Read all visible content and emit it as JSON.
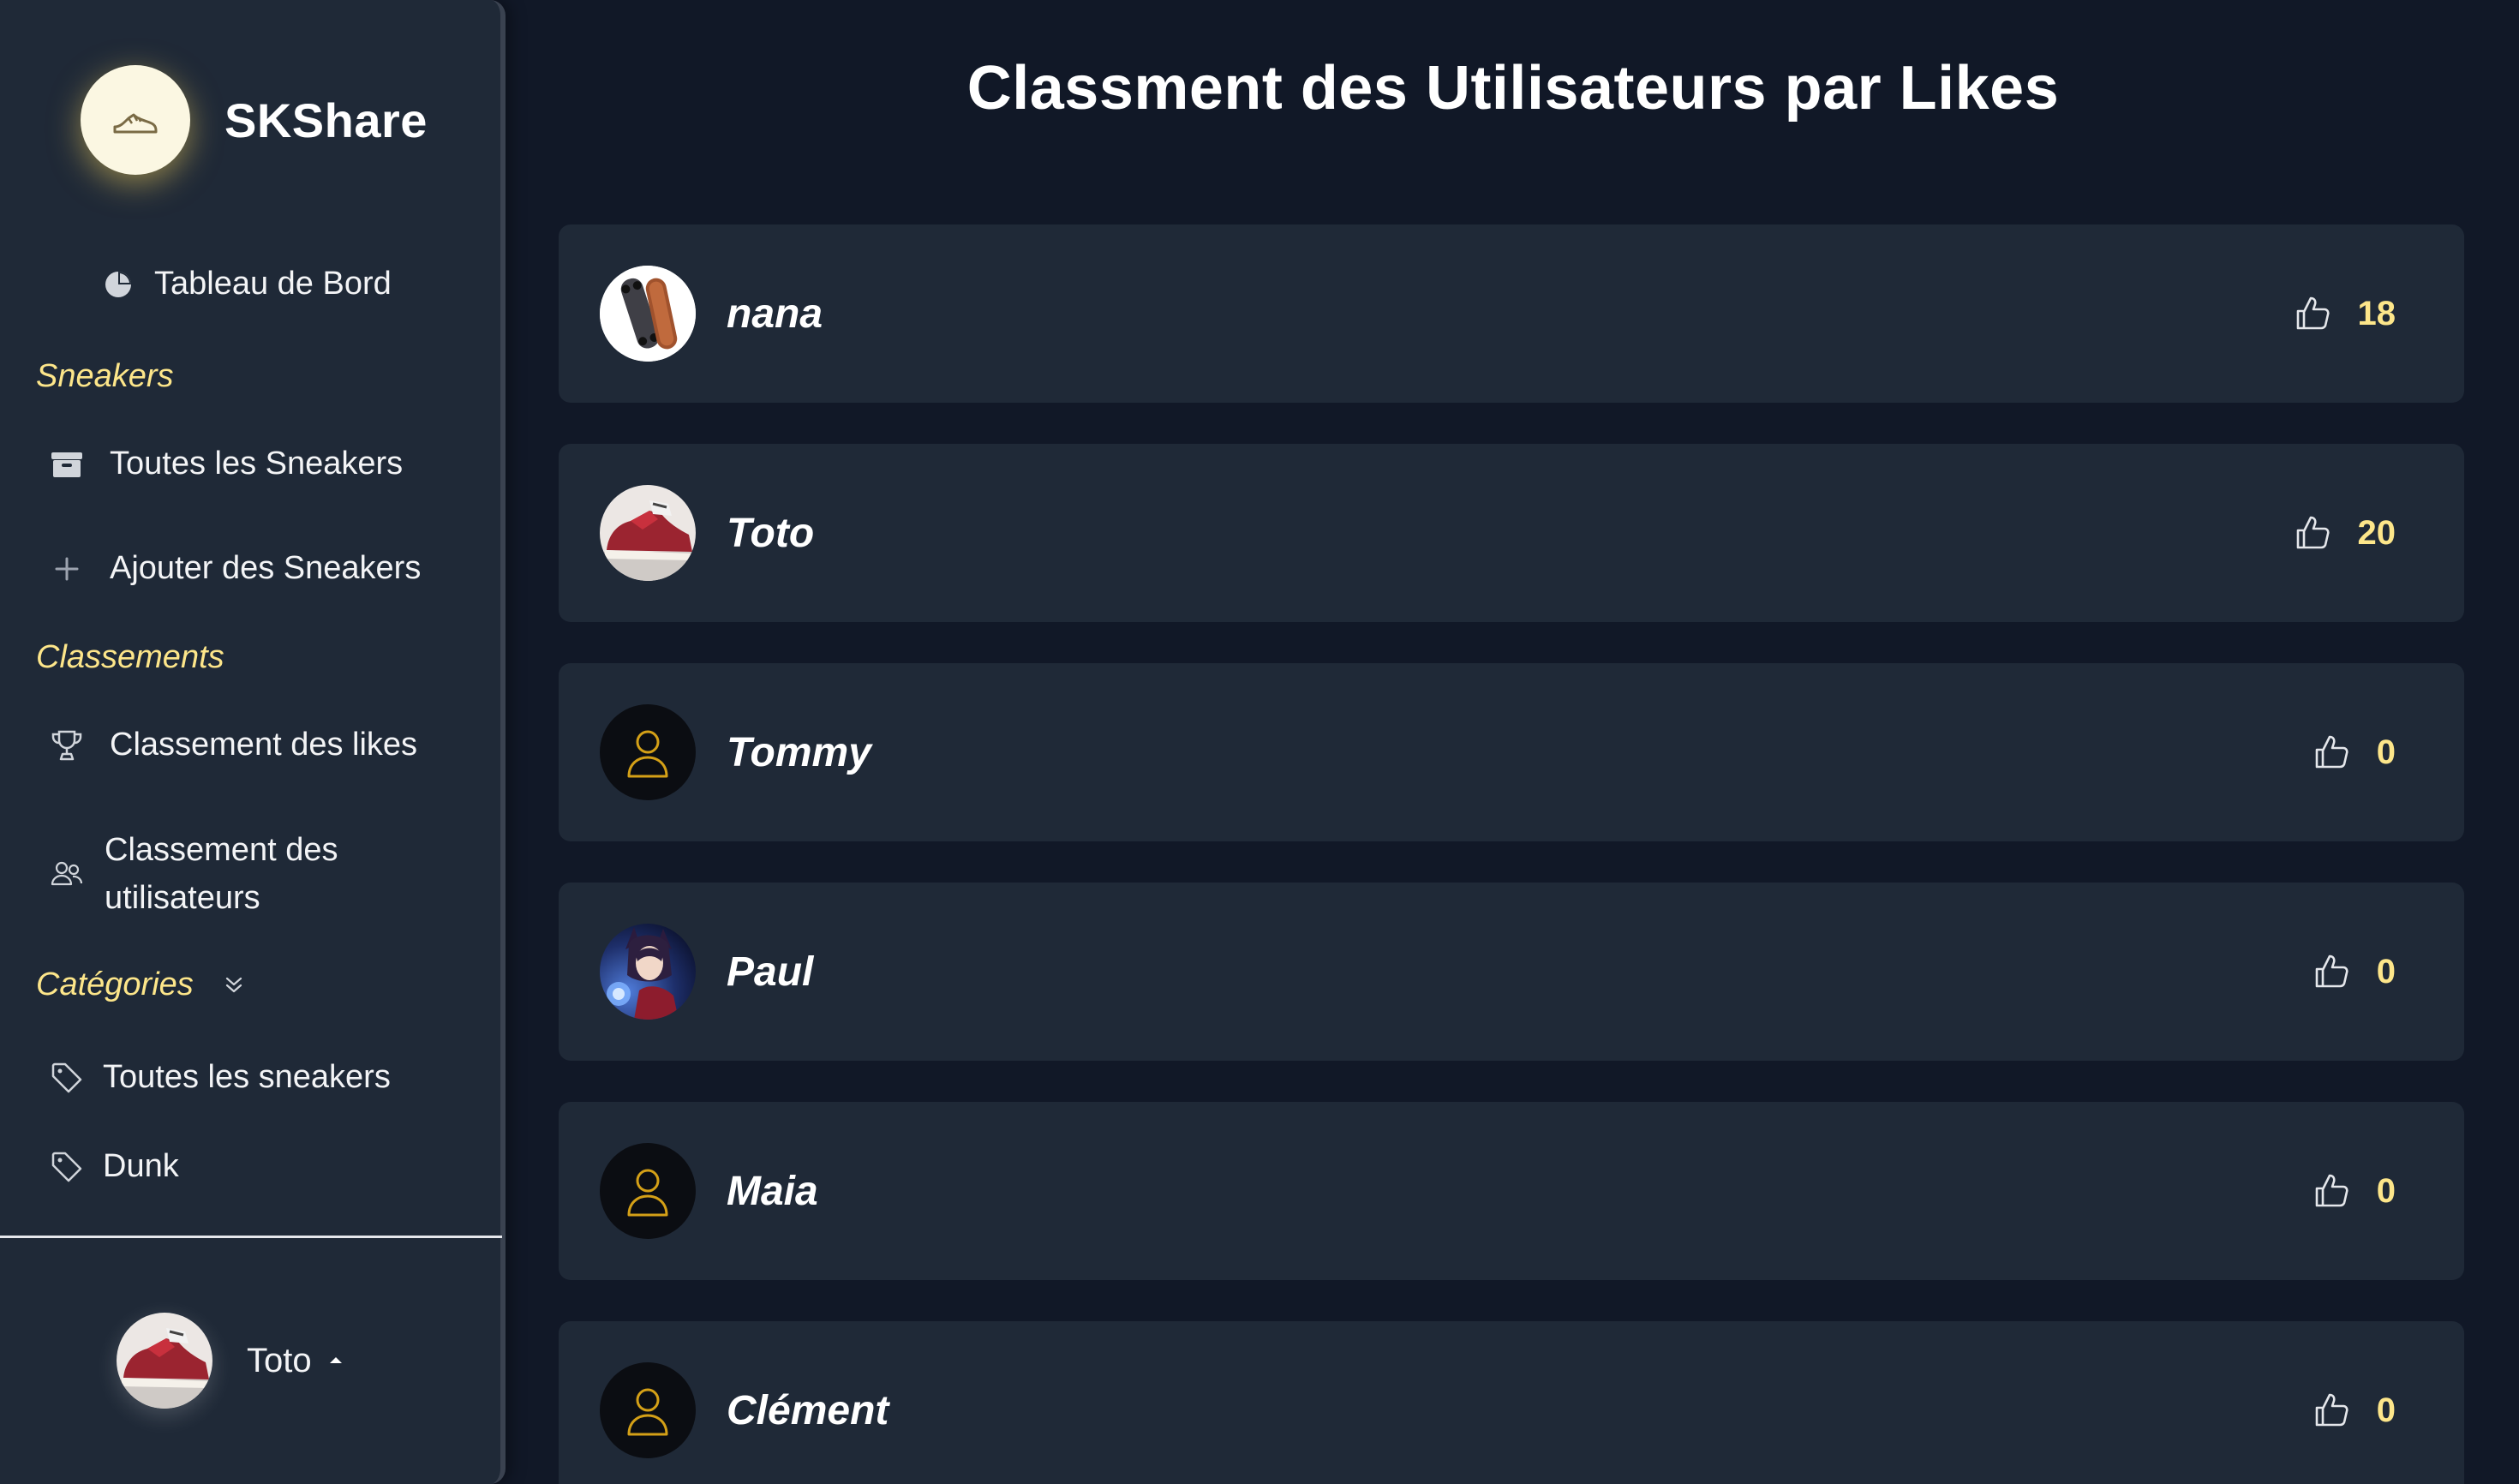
{
  "brand": {
    "name": "SKShare",
    "logo_icon": "sneaker-icon"
  },
  "nav": {
    "dashboard": {
      "label": "Tableau de Bord",
      "icon": "pie-chart-icon"
    },
    "sections": {
      "sneakers": "Sneakers",
      "rankings": "Classements",
      "categories": "Catégories"
    },
    "sneakers_items": [
      {
        "label": "Toutes les Sneakers",
        "icon": "box-icon"
      },
      {
        "label": "Ajouter des Sneakers",
        "icon": "plus-icon"
      }
    ],
    "ranking_items": [
      {
        "label": "Classement des likes",
        "icon": "trophy-icon"
      },
      {
        "label": "Classement des utilisateurs",
        "icon": "users-icon"
      }
    ],
    "category_items": [
      {
        "label": "Toutes les sneakers",
        "icon": "tag-icon"
      },
      {
        "label": "Dunk",
        "icon": "tag-icon"
      }
    ]
  },
  "profile": {
    "name": "Toto",
    "icon": "chevron-up-icon"
  },
  "page": {
    "title": "Classment des Utilisateurs par Likes"
  },
  "leaderboard": [
    {
      "username": "nana",
      "likes": "18",
      "avatar": "skateboard-photo"
    },
    {
      "username": "Toto",
      "likes": "20",
      "avatar": "red-sneaker-photo"
    },
    {
      "username": "Tommy",
      "likes": "0",
      "avatar": "default-user-icon"
    },
    {
      "username": "Paul",
      "likes": "0",
      "avatar": "character-photo"
    },
    {
      "username": "Maia",
      "likes": "0",
      "avatar": "default-user-icon"
    },
    {
      "username": "Clément",
      "likes": "0",
      "avatar": "default-user-icon"
    }
  ],
  "colors": {
    "background": "#111827",
    "panel": "#1f2937",
    "accent": "#fde68a",
    "icon_gold": "#d4a017"
  }
}
